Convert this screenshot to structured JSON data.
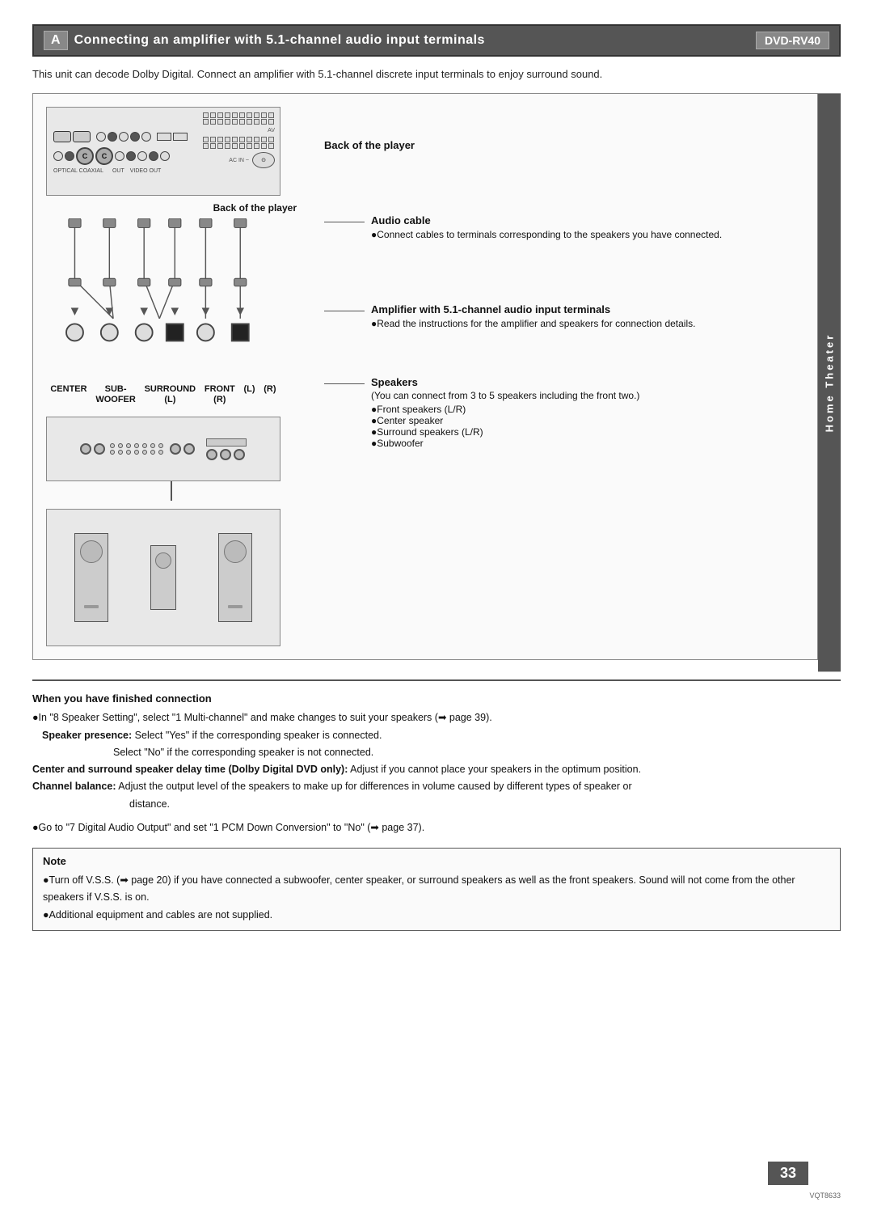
{
  "page": {
    "background_color": "#ffffff"
  },
  "header": {
    "letter": "A",
    "title": "Connecting an amplifier with 5.1-channel audio input terminals",
    "model": "DVD-RV40"
  },
  "intro": {
    "text": "This unit can decode Dolby Digital. Connect an amplifier with 5.1-channel discrete input terminals to enjoy surround sound."
  },
  "diagram": {
    "back_of_player_label": "Back of the player",
    "annotations": [
      {
        "id": "audio_cable",
        "title": "Audio cable",
        "bullets": [
          "Connect cables to terminals corresponding to the speakers you have connected."
        ]
      },
      {
        "id": "amplifier",
        "title": "Amplifier with 5.1-channel audio input terminals",
        "bullets": [
          "Read the instructions for the amplifier and speakers for connection details."
        ]
      },
      {
        "id": "speakers",
        "title": "Speakers",
        "intro": "(You can connect from 3 to 5 speakers including the front two.)",
        "bullets": [
          "Front speakers (L/R)",
          "Center speaker",
          "Surround speakers (L/R)",
          "Subwoofer"
        ]
      }
    ],
    "terminals": [
      {
        "label": "CENTER",
        "type": "circle"
      },
      {
        "label": "SUB-\nWOOFER",
        "type": "circle"
      },
      {
        "label": "SURROUND\n(L)",
        "type": "circle"
      },
      {
        "label": "FRONT\n(R)",
        "type": "filled_square"
      },
      {
        "label": "(L)",
        "type": "circle"
      },
      {
        "label": "(R)",
        "type": "filled_square"
      }
    ]
  },
  "side_label": "Home Theater",
  "notes_section": {
    "title": "When you have finished connection",
    "items": [
      {
        "text": "●In \"8 Speaker Setting\", select \"1 Multi-channel\" and make changes to suit your speakers (➡ page 39)."
      },
      {
        "bold_part": "Speaker presence:",
        "text": " Select \"Yes\" if the corresponding speaker is connected."
      },
      {
        "indent": "Select \"No\" if the corresponding speaker is not connected."
      },
      {
        "bold_part": "Center and surround speaker delay time (Dolby Digital DVD only):",
        "text": "  Adjust if you cannot place your speakers in the optimum position."
      },
      {
        "bold_part": "Channel balance:",
        "text": "  Adjust the output level of the speakers to make up for differences in volume caused by different types of speaker or distance."
      },
      {
        "spacer": true
      },
      {
        "text": "●Go to \"7 Digital Audio Output\" and set \"1 PCM Down Conversion\" to \"No\" (➡ page 37)."
      }
    ]
  },
  "note_box": {
    "title": "Note",
    "items": [
      "●Turn off V.S.S. (➡ page 20) if you have connected a subwoofer, center speaker, or surround speakers as well as the front speakers. Sound will not come from the other speakers if V.S.S. is on.",
      "●Additional equipment and cables are not supplied."
    ]
  },
  "page_number": {
    "number": "33",
    "code": "VQT8633"
  }
}
